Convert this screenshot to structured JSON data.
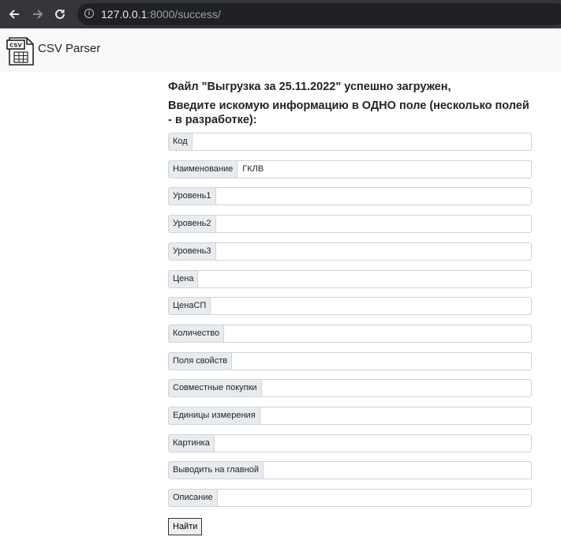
{
  "browser": {
    "url_host": "127.0.0.1",
    "url_rest": ":8000/success/"
  },
  "navbar": {
    "brand": "CSV Parser",
    "logo_text": "CSV"
  },
  "main": {
    "heading_line1": "Файл \"Выгрузка за 25.11.2022\" успешно загружен,",
    "heading_line2": "Введите искомую информацию в ОДНО поле (несколько полей - в разработке):",
    "fields": [
      {
        "label": "Код",
        "value": ""
      },
      {
        "label": "Наименование",
        "value": "ГКЛВ"
      },
      {
        "label": "Уровень1",
        "value": ""
      },
      {
        "label": "Уровень2",
        "value": ""
      },
      {
        "label": "Уровень3",
        "value": ""
      },
      {
        "label": "Цена",
        "value": ""
      },
      {
        "label": "ЦенаСП",
        "value": ""
      },
      {
        "label": "Количество",
        "value": ""
      },
      {
        "label": "Поля свойств",
        "value": ""
      },
      {
        "label": "Совместные покупки",
        "value": ""
      },
      {
        "label": "Единицы измерения",
        "value": ""
      },
      {
        "label": "Картинка",
        "value": ""
      },
      {
        "label": "Выводить на главной",
        "value": ""
      },
      {
        "label": "Описание",
        "value": ""
      }
    ],
    "submit_label": "Найти"
  }
}
